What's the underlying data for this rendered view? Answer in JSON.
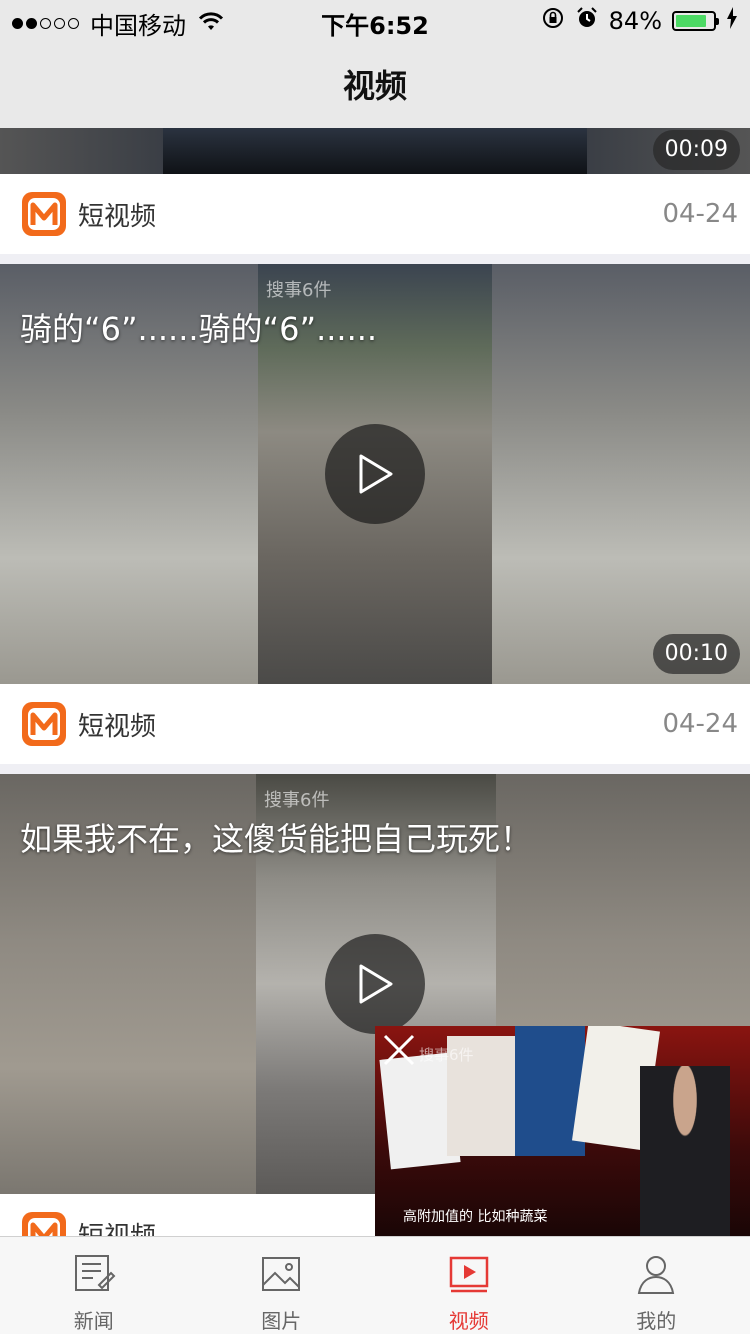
{
  "status_bar": {
    "signal_filled": 2,
    "signal_total": 5,
    "carrier": "中国移动",
    "time": "下午6:52",
    "battery_percent": "84%",
    "battery_level": 0.84
  },
  "nav": {
    "title": "视频"
  },
  "feed": {
    "items": [
      {
        "title": "",
        "duration": "00:09",
        "source": "短视频",
        "date": "04-24"
      },
      {
        "title": "骑的“6”......骑的“6”......",
        "duration": "00:10",
        "source": "短视频",
        "date": "04-24",
        "watermark": "搜事6件"
      },
      {
        "title": "如果我不在，这傻货能把自己玩死！",
        "duration": "",
        "source": "短视频",
        "date": "",
        "watermark": "搜事6件"
      }
    ]
  },
  "mini_player": {
    "caption": "高附加值的 比如种蔬菜",
    "watermark": "搜事6件"
  },
  "tab_bar": {
    "items": [
      {
        "label": "新闻",
        "icon": "news-icon",
        "active": false
      },
      {
        "label": "图片",
        "icon": "picture-icon",
        "active": false
      },
      {
        "label": "视频",
        "icon": "video-icon",
        "active": true
      },
      {
        "label": "我的",
        "icon": "profile-icon",
        "active": false
      }
    ]
  },
  "colors": {
    "accent": "#e53935",
    "logo_orange": "#f26a1b",
    "battery_green": "#4cd964"
  }
}
